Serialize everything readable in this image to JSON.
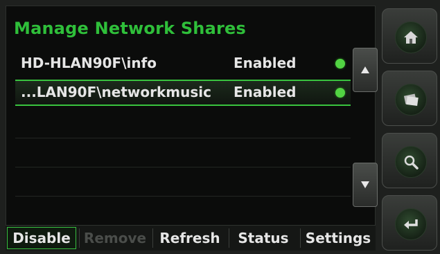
{
  "title": "Manage Network Shares",
  "shares": [
    {
      "name": "HD-HLAN90F\\info",
      "status": "Enabled",
      "selected": false
    },
    {
      "name": "...LAN90F\\networkmusic",
      "status": "Enabled",
      "selected": true
    }
  ],
  "scroll": {
    "up_icon": "up-arrow-icon",
    "down_icon": "down-arrow-icon"
  },
  "tabs": {
    "disable": "Disable",
    "remove": "Remove",
    "refresh": "Refresh",
    "status": "Status",
    "settings": "Settings"
  },
  "side": {
    "home_icon": "home-icon",
    "photos_icon": "photos-icon",
    "search_icon": "search-icon",
    "back_icon": "back-icon"
  },
  "colors": {
    "accent": "#2fbf3a",
    "status_dot": "#52d443"
  }
}
